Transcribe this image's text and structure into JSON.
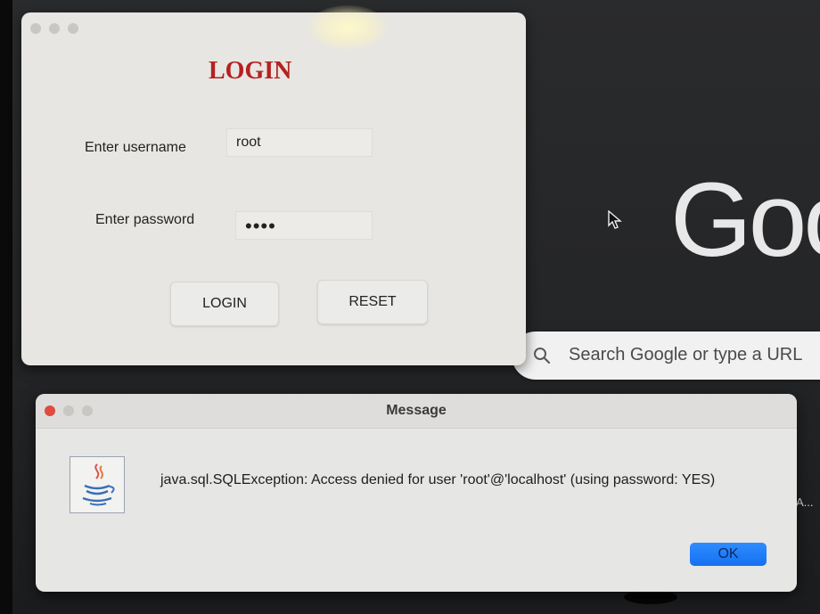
{
  "browser": {
    "logo_text": "Goo",
    "search_placeholder": "Search Google or type a URL",
    "shortcut_fragment": "A..."
  },
  "login_window": {
    "title": "LOGIN",
    "username_label": "Enter username",
    "username_value": "root",
    "password_label": "Enter password",
    "password_masked": "••••",
    "login_button": "LOGIN",
    "reset_button": "RESET"
  },
  "message_dialog": {
    "title": "Message",
    "text": "java.sql.SQLException: Access denied for user 'root'@'localhost' (using password: YES)",
    "ok_button": "OK"
  },
  "colors": {
    "login_title": "#b5211f",
    "ok_button": "#1570f0",
    "close_light": "#e04a3f"
  }
}
